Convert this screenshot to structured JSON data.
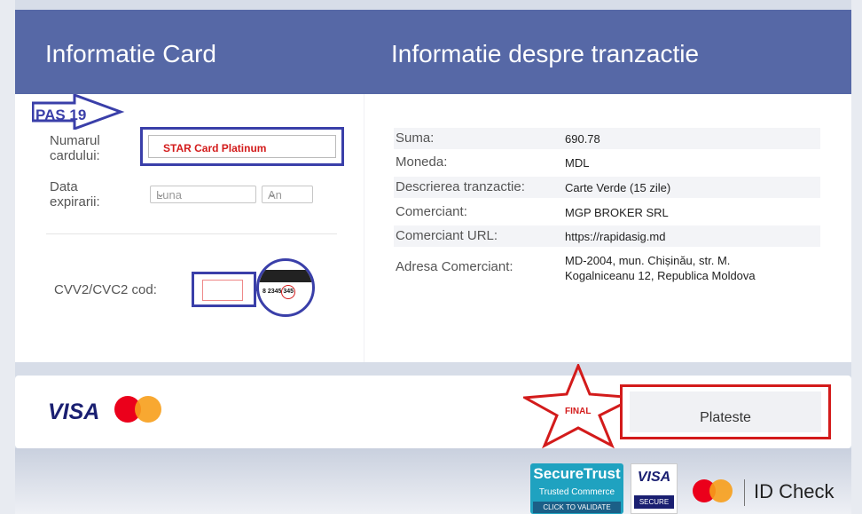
{
  "header": {
    "card_title": "Informatie Card",
    "transaction_title": "Informatie despre tranzactie"
  },
  "card_form": {
    "annotation": "PAS 19",
    "card_number_label": "Numarul cardului:",
    "card_number_value": "STAR Card Platinum",
    "expiry_label": "Data expirarii:",
    "month_select": "Luna",
    "year_select": "An",
    "cvv_label": "CVV2/CVC2 cod:",
    "cvv_card_digits": "8 2345 345"
  },
  "transaction": {
    "rows": [
      {
        "key": "Suma:",
        "value": "690.78"
      },
      {
        "key": "Moneda:",
        "value": "MDL"
      },
      {
        "key": "Descrierea tranzactie:",
        "value": "Carte Verde (15 zile)"
      },
      {
        "key": "Comerciant:",
        "value": "MGP BROKER SRL"
      },
      {
        "key": "Comerciant URL:",
        "value": "https://rapidasig.md"
      },
      {
        "key": "Adresa Comerciant:",
        "value": "MD-2004, mun. Chișinău, str. M. Kogalniceanu 12, Republica Moldova"
      }
    ]
  },
  "payment": {
    "visa_logo": "VISA",
    "pay_button": "Plateste",
    "final_annotation": "FINAL"
  },
  "trust_badges": {
    "securetrust": "SecureTrust",
    "securetrust_sub": "Trusted Commerce",
    "securetrust_cta": "CLICK TO VALIDATE",
    "visa_secure_top": "VISA",
    "visa_secure_bottom": "SECURE",
    "id_check": "ID Check"
  },
  "colors": {
    "header_bg": "#5668a6",
    "annotation_blue": "#3a3fa9",
    "annotation_red": "#d31b1b",
    "visa_blue": "#1a1f71",
    "mc_red": "#eb001b",
    "mc_orange": "#f79e1b"
  }
}
